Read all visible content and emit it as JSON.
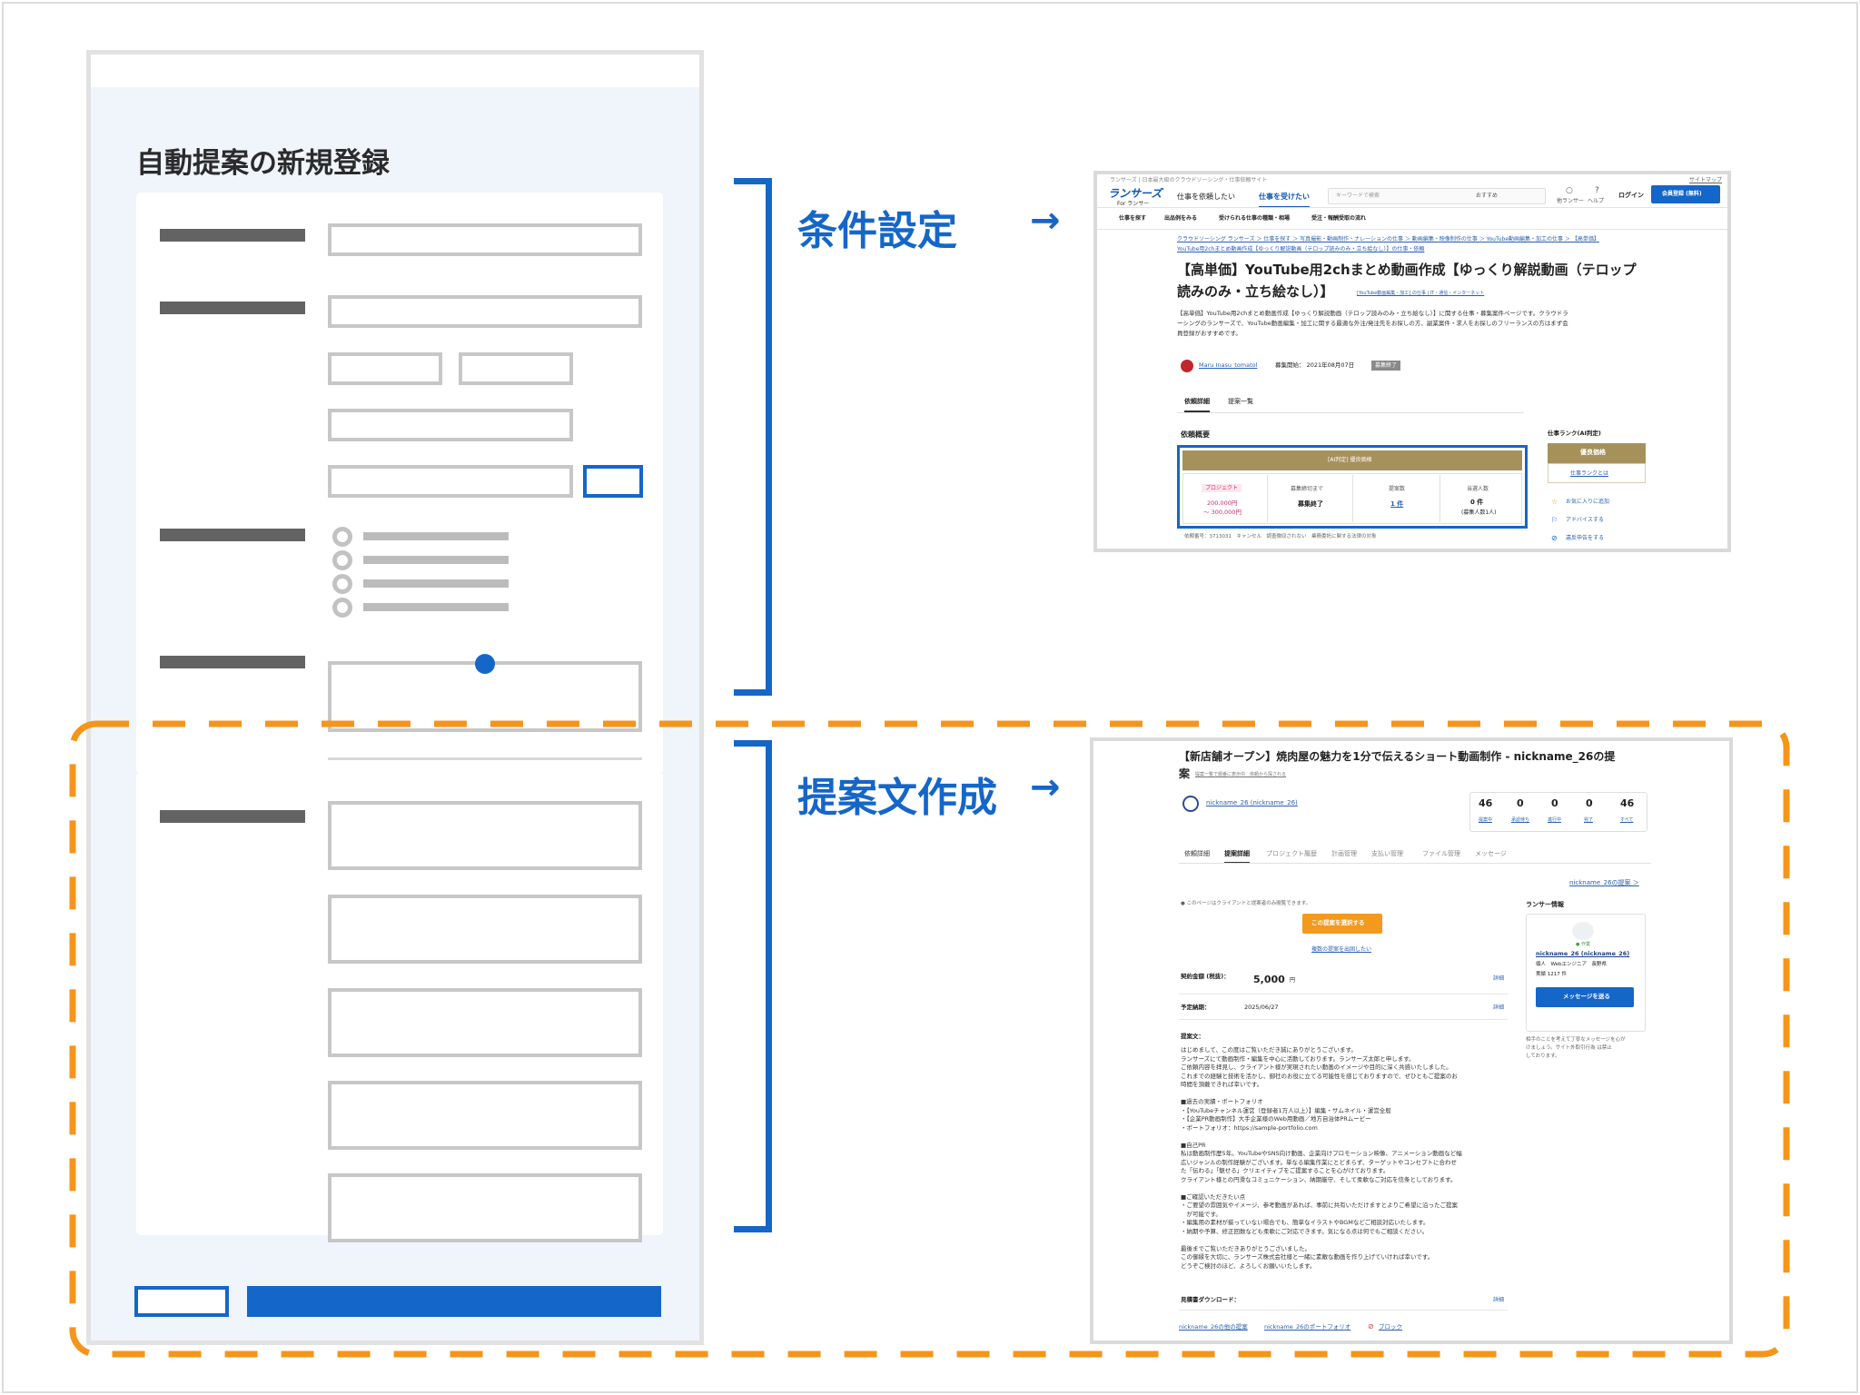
{
  "form": {
    "title": "自動提案の新規登録"
  },
  "labels": {
    "condition": "条件設定",
    "proposal": "提案文作成",
    "arrow": "→"
  },
  "shot1": {
    "topline": "ランサーズ | 日本最大級のクラウドソーシング・仕事依頼サイト",
    "sitemap": "サイトマップ",
    "logo": "ランサーズ",
    "logo_sub": "For ランサー",
    "nav": [
      "仕事を依頼したい",
      "仕事を受けたい"
    ],
    "search_placeholder": "キーワードで検索",
    "sort": "おすすめ",
    "icon_labels": [
      "他ランサー",
      "ヘルプ"
    ],
    "login": "ログイン",
    "register": "会員登録 (無料)",
    "subnav": [
      "仕事を探す",
      "出品例をみる",
      "受けられる仕事の種類・相場",
      "受注・報酬受取の流れ"
    ],
    "breadcrumb1": "クラウドソーシング ランサーズ ＞ 仕事を探す ＞ 写真撮影・動画制作・ナレーションの仕事 ＞ 動画編集・映像制作の仕事 ＞ YouTube動画編集・加工の仕事 ＞ 【高単価】",
    "breadcrumb2": "YouTube用2chまとめ動画作成【ゆっくり解説動画（テロップ読みのみ・立ち絵なし）】の仕事・依頼",
    "title1": "【高単価】YouTube用2chまとめ動画作成【ゆっくり解説動画（テロップ",
    "title2": "読みのみ・立ち絵なし）】",
    "category_tag": "[YouTube動画編集・加工] の仕事 | IT・通信・インターネット",
    "desc1": "【高単価】YouTube用2chまとめ動画作成【ゆっくり解説動画（テロップ読みのみ・立ち絵なし）】に関する仕事・募集案件ページです。クラウドラ",
    "desc2": "ーシングのランサーズで、YouTube動画編集・加工に関する最適な外注/発注先をお探しの方、副業案件・求人をお探しのフリーランスの方はまず会",
    "desc3": "員登録がおすすめです。",
    "client": "Maru Inasu_tomatol",
    "posted": "募集開始： 2021年08月07日",
    "status_badge": "募集終了",
    "tabs": [
      "依頼詳細",
      "提案一覧"
    ],
    "overview": "依頼概要",
    "rank_header": "[AI判定] 優良価格",
    "project_badge": "プロジェクト",
    "price": "200,000円",
    "price2": "〜 300,000円",
    "c2_label": "募集締切まで",
    "c2_value": "募集終了",
    "c3_label": "提案数",
    "c3_value": "1 件",
    "c4_label": "当選人数",
    "c4_value": "0 件",
    "c4_sub": "(募集人数1人)",
    "footer": "依頼番号：3713031　キャンセル　調査徴収されない　業務委託に関する法律の対象",
    "side_title": "仕事ランク(AI判定)",
    "side_badge": "優良価格",
    "side_link": "仕事ランクとは",
    "side_links": [
      "お気に入りに追加",
      "アドバイスする",
      "違反申告をする"
    ]
  },
  "shot2": {
    "title1": "【新店舗オープン】焼肉屋の魅力を1分で伝えるショート動画制作 - nickname_26の提",
    "title2": "案",
    "small_links": "提案一覧で順番に表示中　依頼から探される",
    "user": "nickname_26 (nickname_26)",
    "stats": [
      {
        "v": "46",
        "l": "提案中"
      },
      {
        "v": "0",
        "l": "承認待ち"
      },
      {
        "v": "0",
        "l": "進行中"
      },
      {
        "v": "0",
        "l": "完了"
      },
      {
        "v": "46",
        "l": "すべて"
      }
    ],
    "tabs": [
      "依頼詳細",
      "提案詳細",
      "プロジェクト履歴",
      "計画管理",
      "支払い管理",
      "ファイル管理",
      "メッセージ"
    ],
    "proposal_link": "nickname_26の提案 ＞",
    "notice": "● このページはクライアントと提案者のみ閲覧できます。",
    "select_btn": "この提案を選択する",
    "multi": "複数の提案を出固したい",
    "fee_label": "契約金額 (税抜)：",
    "fee": "5,000",
    "fee_unit": "円",
    "detail": "詳細",
    "due_label": "予定納期：",
    "due": "2025/06/27",
    "body_label": "提案文：",
    "body": [
      "はじめまして、この度はご覧いただき誠にありがとうございます。",
      "ランサーズにて動画制作・編集を中心に活動しております。ランサーズ太郎と申します。",
      "ご依頼内容を拝見し、クライアント様が実現されたい動画のイメージや目的に深く共感いたしました。",
      "これまでの経験と技術を活かし、御社のお役に立てる可能性を感じておりますので、ぜひともご提案のお",
      "時間を頂戴できれば幸いです。",
      "",
      "■過去の実績・ポートフォリオ",
      "・【YouTubeチャンネル運営（登録者1万人以上）】編集・サムネイル・運営全般",
      "・【企業PR動画制作】大手企業様のWeb用動画／地方自治体PRムービー",
      "・ポートフォリオ：https://sample-portfolio.com",
      "",
      "■自己PR",
      "私は動画制作歴5年。YouTubeやSNS向け動画、企業向けプロモーション映像、アニメーション動画など幅",
      "広いジャンルの制作経験がございます。単なる編集作業にとどまらず、ターゲットやコンセプトに合わせ",
      "た「伝わる」「魅せる」クリエイティブをご提案することを心がけております。",
      "クライアント様との円滑なコミュニケーション、納期厳守、そして柔軟なご対応を信条としております。",
      "",
      "■ご確認いただきたい点",
      "・ご要望の雰囲気やイメージ、参考動画があれば、事前に共有いただけますとよりご希望に沿ったご提案",
      "　が可能です。",
      "・編集用の素材が揃っていない場合でも、簡単なイラストやBGMなどご相談対応いたします。",
      "・納期や予算、修正回数なども柔軟にご対応できます。気になる点は何でもご相談ください。",
      "",
      "最後までご覧いただきありがとうございました。",
      "この御縁を大切に、ランサーズ株式会社様と一緒に素敵な動画を作り上げていければ幸いです。",
      "どうぞご検討のほど、よろしくお願いいたします。"
    ],
    "estimate": "見積書ダウンロード：",
    "bottom_links": [
      "nickname_26の他の提案",
      "nickname_26のポートフォリオ",
      "ブロック"
    ],
    "lancer_info": "ランサー情報",
    "lancer_name": "nickname_26 (nickname_26)",
    "lancer_status": "● 作業",
    "lancer_meta": "個人　Webエンジニア　長野県",
    "lancer_record": "実績 1217 件",
    "message_btn": "メッセージを送る",
    "note1": "相手のことを考えて丁寧なメッセージを心が",
    "note2": "けましょう。サイト外取引行為 は禁止",
    "note3": "しております。"
  }
}
